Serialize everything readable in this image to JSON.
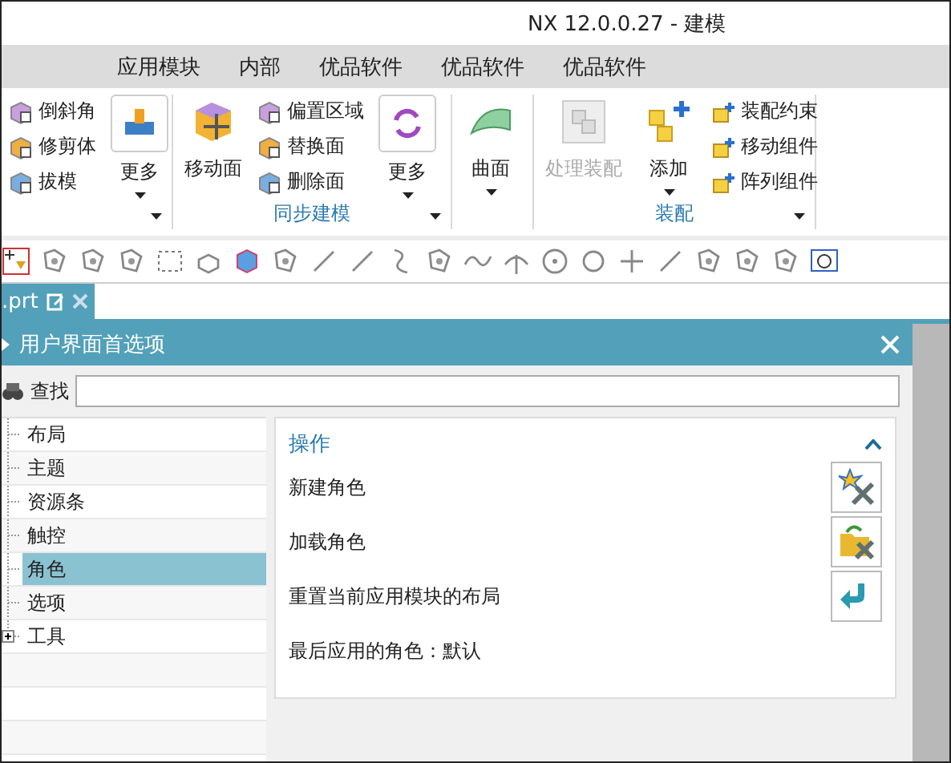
{
  "window": {
    "title": "NX 12.0.0.27 - 建模"
  },
  "menu": [
    {
      "label": "应用模块"
    },
    {
      "label": "内部"
    },
    {
      "label": "优品软件"
    },
    {
      "label": "优品软件"
    },
    {
      "label": "优品软件"
    }
  ],
  "ribbon": {
    "groups": [
      {
        "launcher": true,
        "items": [
          {
            "kind": "stack",
            "entries": [
              {
                "label": "倒斜角"
              },
              {
                "label": "修剪体"
              },
              {
                "label": "拔模"
              }
            ]
          },
          {
            "kind": "more",
            "label": "更多"
          }
        ]
      },
      {
        "title": "同步建模",
        "launcher": true,
        "items": [
          {
            "kind": "large",
            "label": "移动面",
            "dropdown": false,
            "disabled": false
          },
          {
            "kind": "stack",
            "entries": [
              {
                "label": "偏置区域"
              },
              {
                "label": "替换面"
              },
              {
                "label": "删除面"
              }
            ]
          },
          {
            "kind": "more",
            "label": "更多"
          }
        ]
      },
      {
        "launcher": false,
        "items": [
          {
            "kind": "large",
            "label": "曲面",
            "dropdown": true,
            "disabled": false
          }
        ]
      },
      {
        "title": "装配",
        "launcher": true,
        "items": [
          {
            "kind": "large",
            "label": "处理装配",
            "dropdown": false,
            "disabled": true
          },
          {
            "kind": "large",
            "label": "添加",
            "dropdown": true,
            "disabled": false
          },
          {
            "kind": "stack",
            "entries": [
              {
                "label": "装配约束"
              },
              {
                "label": "移动组件"
              },
              {
                "label": "阵列组件"
              }
            ]
          }
        ]
      }
    ]
  },
  "file_tab": {
    "label": ".prt"
  },
  "dialog": {
    "title": "用户界面首选项",
    "search": {
      "label": "查找"
    },
    "tree": [
      {
        "label": "布局",
        "kind": "leaf",
        "selected": false
      },
      {
        "label": "主题",
        "kind": "leaf",
        "selected": false
      },
      {
        "label": "资源条",
        "kind": "leaf",
        "selected": false
      },
      {
        "label": "触控",
        "kind": "leaf",
        "selected": false
      },
      {
        "label": "角色",
        "kind": "leaf",
        "selected": true
      },
      {
        "label": "选项",
        "kind": "leaf",
        "selected": false
      },
      {
        "label": "工具",
        "kind": "folder",
        "expanded": false,
        "selected": false
      }
    ],
    "section": {
      "title": "操作",
      "expanded": true,
      "rows": [
        {
          "kind": "button",
          "label": "新建角色"
        },
        {
          "kind": "button",
          "label": "加载角色"
        },
        {
          "kind": "button",
          "label": "重置当前应用模块的布局"
        },
        {
          "kind": "text",
          "label": "最后应用的角色：默认"
        }
      ]
    }
  }
}
